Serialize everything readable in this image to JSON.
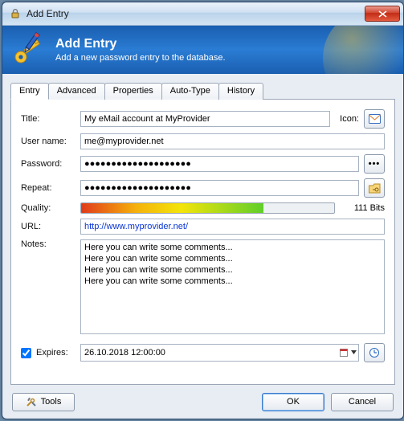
{
  "window": {
    "title": "Add Entry"
  },
  "header": {
    "title": "Add Entry",
    "subtitle": "Add a new password entry to the database."
  },
  "tabs": [
    "Entry",
    "Advanced",
    "Properties",
    "Auto-Type",
    "History"
  ],
  "active_tab": "Entry",
  "labels": {
    "title": "Title:",
    "icon": "Icon:",
    "username": "User name:",
    "password": "Password:",
    "repeat": "Repeat:",
    "quality": "Quality:",
    "url": "URL:",
    "notes": "Notes:",
    "expires": "Expires:"
  },
  "values": {
    "title": "My eMail account at MyProvider",
    "username": "me@myprovider.net",
    "password": "●●●●●●●●●●●●●●●●●●●●",
    "repeat": "●●●●●●●●●●●●●●●●●●●●",
    "quality_bits": "111 Bits",
    "quality_percent": 72,
    "url": "http://www.myprovider.net/",
    "notes": "Here you can write some comments...\nHere you can write some comments...\nHere you can write some comments...\nHere you can write some comments...",
    "expires_checked": true,
    "expires": "26.10.2018 12:00:00"
  },
  "footer": {
    "tools": "Tools",
    "ok": "OK",
    "cancel": "Cancel"
  },
  "colors": {
    "accent": "#1a5fb0",
    "link": "#0a35d4"
  },
  "icons": {
    "window": "lock-icon",
    "header": "key-pencil-icon",
    "entry_icon_button": "envelope-icon",
    "reveal": "dots-icon",
    "autotype_builder": "folder-key-icon",
    "datepicker": "calendar-dropdown-icon",
    "clock": "clock-icon",
    "tools": "tools-icon",
    "close": "close-icon"
  }
}
